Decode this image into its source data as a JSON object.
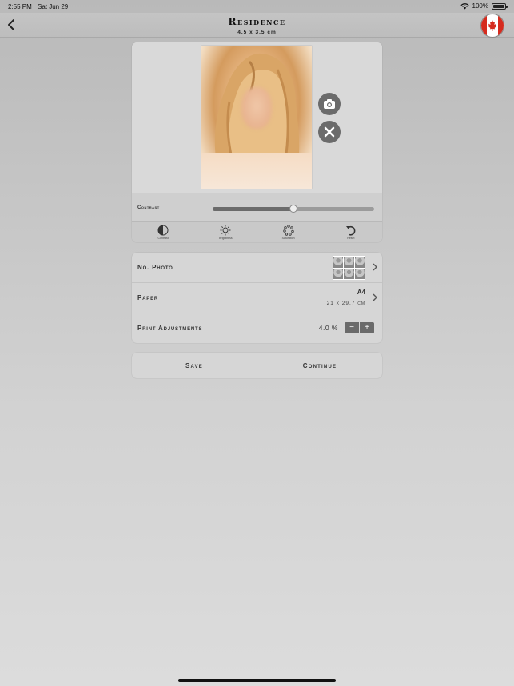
{
  "status_bar": {
    "time": "2:55 PM",
    "date": "Sat Jun 29",
    "battery": "100%"
  },
  "header": {
    "title": "Residence",
    "subtitle": "4.5 x 3.5 cm"
  },
  "photo_editor": {
    "contrast_label": "Contrast",
    "contrast_value": 0.5,
    "tools": [
      {
        "label": "Contrast",
        "icon": "contrast-icon"
      },
      {
        "label": "Brightness",
        "icon": "brightness-icon"
      },
      {
        "label": "Saturation",
        "icon": "saturation-icon"
      },
      {
        "label": "Reset",
        "icon": "reset-icon"
      }
    ]
  },
  "settings": {
    "photos": {
      "label": "No. Photo"
    },
    "paper": {
      "label": "Paper",
      "size": "A4",
      "dimensions": "21 x 29.7 cm"
    },
    "adjustments": {
      "label": "Print Adjustments",
      "value": "4.0 %",
      "minus": "−",
      "plus": "+"
    }
  },
  "actions": {
    "save": "Save",
    "continue": "Continue"
  },
  "colors": {
    "accent": "#6b6b6b",
    "flag_red": "#d52b1e"
  }
}
